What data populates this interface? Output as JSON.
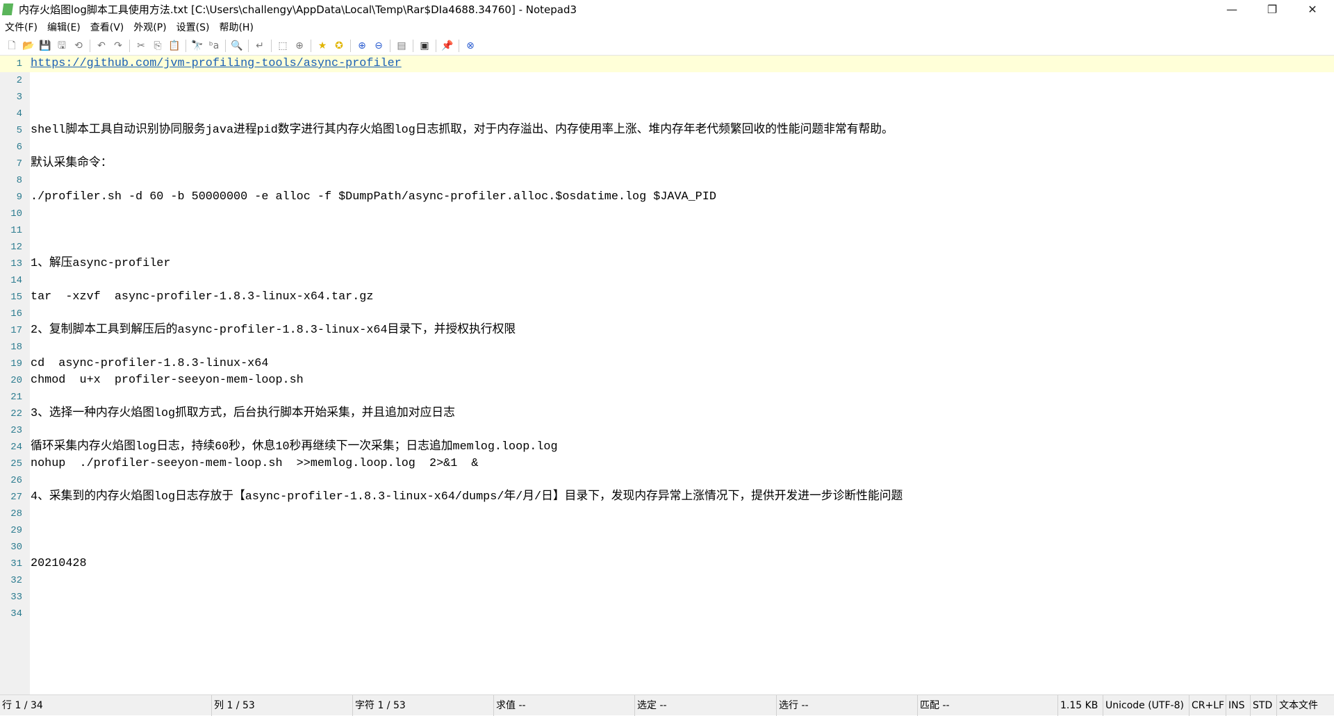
{
  "window": {
    "title": "内存火焰图log脚本工具使用方法.txt [C:\\Users\\challengy\\AppData\\Local\\Temp\\Rar$DIa4688.34760] - Notepad3",
    "minimize": "—",
    "restore": "❐",
    "close": "✕"
  },
  "menu": [
    "文件(F)",
    "编辑(E)",
    "查看(V)",
    "外观(P)",
    "设置(S)",
    "帮助(H)"
  ],
  "toolbar": [
    "new-file",
    "open",
    "save",
    "save-as",
    "reload",
    "|",
    "undo",
    "redo",
    "|",
    "cut",
    "copy",
    "paste",
    "|",
    "find",
    "replace",
    "|",
    "find-in-files",
    "|",
    "wrap",
    "|",
    "select-all",
    "zoom-select",
    "|",
    "bookmark",
    "add-bookmark",
    "|",
    "zoom-in",
    "zoom-out",
    "|",
    "scheme",
    "|",
    "terminal",
    "|",
    "pin",
    "|",
    "exit"
  ],
  "lines": [
    "https://github.com/jvm-profiling-tools/async-profiler",
    "",
    "",
    "",
    "shell脚本工具自动识别协同服务java进程pid数字进行其内存火焰图log日志抓取，对于内存溢出、内存使用率上涨、堆内存年老代频繁回收的性能问题非常有帮助。",
    "",
    "默认采集命令：",
    "",
    "./profiler.sh -d 60 -b 50000000 -e alloc -f $DumpPath/async-profiler.alloc.$osdatime.log $JAVA_PID",
    "",
    "",
    "",
    "1、解压async-profiler",
    "",
    "tar  -xzvf  async-profiler-1.8.3-linux-x64.tar.gz",
    "",
    "2、复制脚本工具到解压后的async-profiler-1.8.3-linux-x64目录下，并授权执行权限",
    "",
    "cd  async-profiler-1.8.3-linux-x64",
    "chmod  u+x  profiler-seeyon-mem-loop.sh",
    "",
    "3、选择一种内存火焰图log抓取方式，后台执行脚本开始采集，并且追加对应日志",
    "",
    "循环采集内存火焰图log日志，持续60秒，休息10秒再继续下一次采集；日志追加memlog.loop.log",
    "nohup  ./profiler-seeyon-mem-loop.sh  >>memlog.loop.log  2>&1  &",
    "",
    "4、采集到的内存火焰图log日志存放于【async-profiler-1.8.3-linux-x64/dumps/年/月/日】目录下，发现内存异常上涨情况下，提供开发进一步诊断性能问题",
    "",
    "",
    "",
    "20210428",
    "",
    "",
    ""
  ],
  "status": [
    "行 1 / 34",
    "列 1 / 53",
    "字符 1 / 53",
    "求值 --",
    "选定 --",
    "选行 --",
    "匹配 --",
    "1.15 KB",
    "Unicode (UTF-8)",
    "CR+LF",
    "INS",
    "STD",
    "文本文件"
  ]
}
